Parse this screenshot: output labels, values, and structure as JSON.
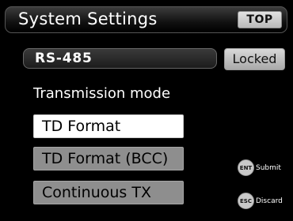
{
  "header": {
    "title": "System Settings",
    "top_button": "TOP"
  },
  "port": {
    "value": "RS-485",
    "lock_button": "Locked"
  },
  "transmission": {
    "label": "Transmission mode",
    "options": [
      {
        "label": "TD Format",
        "selected": true
      },
      {
        "label": "TD Format (BCC)",
        "selected": false
      },
      {
        "label": "Continuous TX",
        "selected": false
      }
    ]
  },
  "keys": {
    "ent": {
      "key": "ENT",
      "label": "Submit"
    },
    "esc": {
      "key": "ESC",
      "label": "Discard"
    }
  }
}
